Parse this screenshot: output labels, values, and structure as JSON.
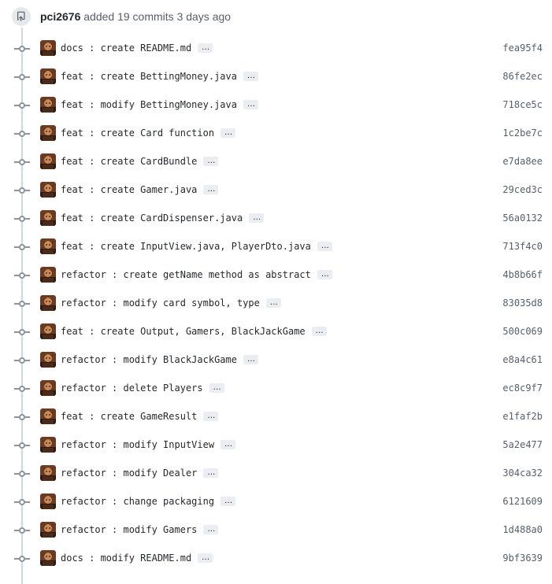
{
  "header": {
    "user": "pci2676",
    "action": "added 19 commits",
    "time": "3 days ago",
    "icon": "repo-push-icon"
  },
  "ellipsis_label": "…",
  "commits": [
    {
      "message": "docs : create README.md",
      "sha": "fea95f4"
    },
    {
      "message": "feat : create BettingMoney.java",
      "sha": "86fe2ec"
    },
    {
      "message": "feat : modify BettingMoney.java",
      "sha": "718ce5c"
    },
    {
      "message": "feat : create Card function",
      "sha": "1c2be7c"
    },
    {
      "message": "feat : create CardBundle",
      "sha": "e7da8ee"
    },
    {
      "message": "feat : create Gamer.java",
      "sha": "29ced3c"
    },
    {
      "message": "feat : create CardDispenser.java",
      "sha": "56a0132"
    },
    {
      "message": "feat : create InputView.java, PlayerDto.java",
      "sha": "713f4c0"
    },
    {
      "message": "refactor : create getName method as abstract",
      "sha": "4b8b66f"
    },
    {
      "message": "refactor : modify card symbol, type",
      "sha": "83035d8"
    },
    {
      "message": "feat : create Output, Gamers, BlackJackGame",
      "sha": "500c069"
    },
    {
      "message": "refactor : modify BlackJackGame",
      "sha": "e8a4c61"
    },
    {
      "message": "refactor : delete Players",
      "sha": "ec8c9f7"
    },
    {
      "message": "feat : create GameResult",
      "sha": "e1faf2b"
    },
    {
      "message": "refactor : modify InputView",
      "sha": "5a2e477"
    },
    {
      "message": "refactor : modify Dealer",
      "sha": "304ca32"
    },
    {
      "message": "refactor : change packaging",
      "sha": "6121609"
    },
    {
      "message": "refactor : modify Gamers",
      "sha": "1d488a0"
    },
    {
      "message": "docs : modify README.md",
      "sha": "9bf3639"
    }
  ],
  "colors": {
    "text": "#24292f",
    "muted": "#57606a",
    "timeline": "#d0d7de",
    "node": "#8c959f",
    "ellipsis_bg": "#eaeef2"
  }
}
